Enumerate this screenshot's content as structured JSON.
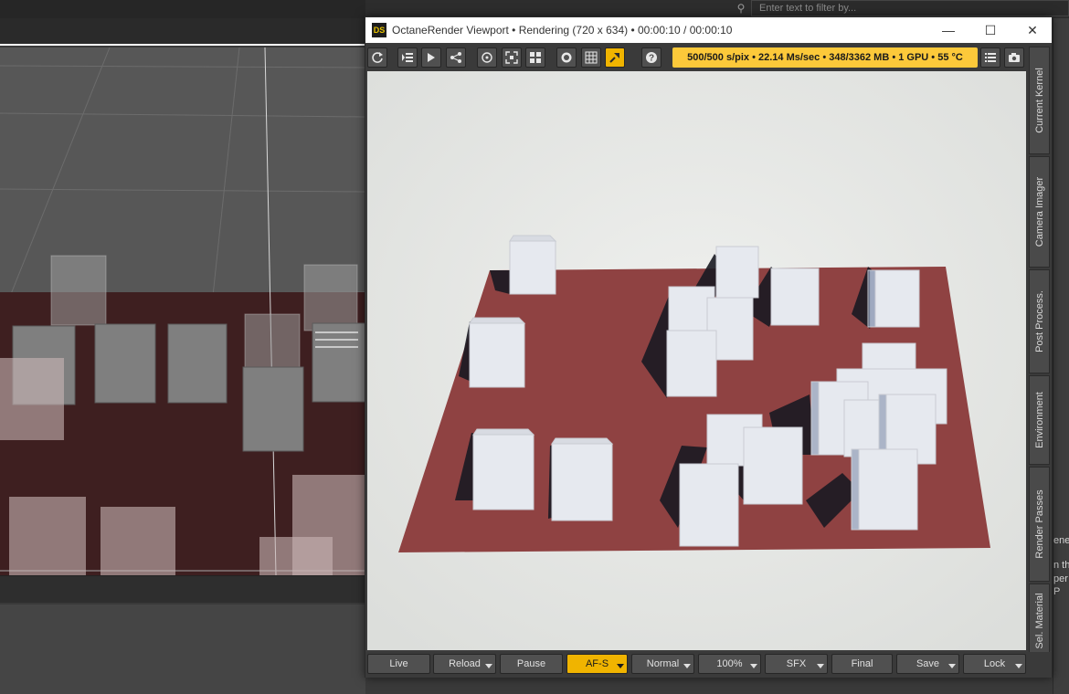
{
  "host": {
    "filter_placeholder": "Enter text to filter by...",
    "side_text": [
      "ene",
      "n the",
      "per",
      "P"
    ]
  },
  "window": {
    "logo_text": "DS",
    "title": "OctaneRender Viewport • Rendering (720 x 634) • 00:00:10 / 00:00:10",
    "minimize_symbol": "—",
    "maximize_symbol": "☐",
    "close_symbol": "✕"
  },
  "toolbar": {
    "icons": [
      "refresh-icon",
      "scene-outliner-icon",
      "send-to-icon",
      "node-graph-icon",
      "focus-picker-icon",
      "fit-region-icon",
      "layout-grid-icon",
      "record-icon",
      "grid-icon",
      "pin-active-icon",
      "help-icon"
    ],
    "status": "500/500 s/pix • 22.14 Ms/sec • 348/3362 MB • 1 GPU • 55 °C",
    "right_icons": [
      "list-icon",
      "camera-icon"
    ]
  },
  "side_tabs": [
    "Current Kernel",
    "Camera Imager",
    "Post Process.",
    "Environment",
    "Render Passes",
    "Sel. Material"
  ],
  "bottom_buttons": [
    {
      "label": "Live",
      "dropdown": false,
      "active": false
    },
    {
      "label": "Reload",
      "dropdown": true,
      "active": false
    },
    {
      "label": "Pause",
      "dropdown": false,
      "active": false
    },
    {
      "label": "AF-S",
      "dropdown": true,
      "active": true
    },
    {
      "label": "Normal",
      "dropdown": true,
      "active": false
    },
    {
      "label": "100%",
      "dropdown": true,
      "active": false
    },
    {
      "label": "SFX",
      "dropdown": true,
      "active": false
    },
    {
      "label": "Final",
      "dropdown": false,
      "active": false
    },
    {
      "label": "Save",
      "dropdown": true,
      "active": false
    },
    {
      "label": "Lock",
      "dropdown": true,
      "active": false
    }
  ],
  "colors": {
    "accent": "#f0b400",
    "status_bg": "#fcc93a",
    "floor": "#8f4242",
    "render_bg": "#e8e9e6",
    "cube": "#e6e9ef"
  }
}
